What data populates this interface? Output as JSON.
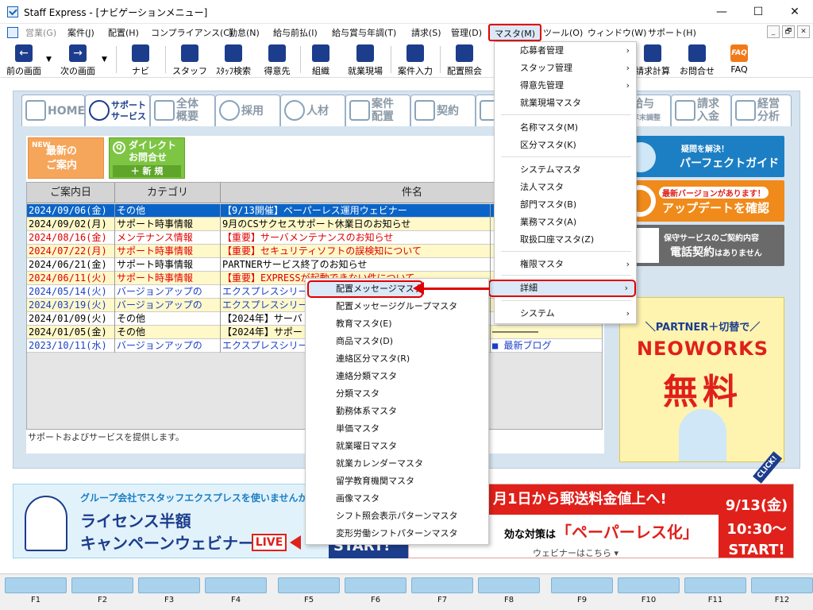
{
  "window": {
    "title": "Staff Express - [ナビゲーションメニュー]",
    "minimize": "—",
    "maximize": "☐",
    "close": "✕"
  },
  "menubar": {
    "items": [
      "営業(G)",
      "案件(J)",
      "配置(H)",
      "コンプライアンス(C)",
      "勤怠(N)",
      "給与前払(I)",
      "給与賞与年調(T)",
      "請求(S)",
      "管理(D)",
      "マスタ(M)",
      "ツール(O)",
      "ウィンドウ(W)",
      "サポート(H)"
    ],
    "mdi": [
      "_",
      "🗗",
      "✕"
    ]
  },
  "toolbar": {
    "items": [
      "前の画面",
      "次の画面",
      "ナビ",
      "スタッフ",
      "ｽﾀｯﾌ検索",
      "得意先",
      "組織",
      "就業現場",
      "案件入力",
      "配置照会",
      "請求計算",
      "お問合せ",
      "FAQ"
    ],
    "faq_icon": "FAQ"
  },
  "tabs": [
    {
      "label": "HOME"
    },
    {
      "label1": "サポート",
      "label2": "サービス"
    },
    {
      "label1": "全体",
      "label2": "概要"
    },
    {
      "label": "採用"
    },
    {
      "label": "人材"
    },
    {
      "label1": "案件",
      "label2": "配置"
    },
    {
      "label": "契約"
    },
    {
      "label1": "給与",
      "label2": "年末調整"
    },
    {
      "label1": "請求",
      "label2": "入金"
    },
    {
      "label1": "経営",
      "label2": "分析"
    }
  ],
  "buttons": {
    "new_vert": "NEW",
    "new_line1": "最新の",
    "new_line2": "ご案内",
    "direct_q": "Q",
    "direct_line1": "ダイレクト",
    "direct_line2": "お問合せ",
    "direct_sub": "＋ 新 規"
  },
  "news": {
    "headers": [
      "ご案内日",
      "カテゴリ",
      "件名"
    ],
    "rows": [
      {
        "date": "2024/09/06(金)",
        "cat": "その他",
        "title": "【9/13開催】ペーパーレス運用ウェビナー",
        "extra": "",
        "style": "selected"
      },
      {
        "date": "2024/09/02(月)",
        "cat": "サポート時事情報",
        "title": "9月のCSサクセスサポート休業日のお知らせ",
        "extra": "",
        "style": "yellow"
      },
      {
        "date": "2024/08/16(金)",
        "cat": "メンテナンス情報",
        "title": "【重要】サーバメンテナンスのお知らせ",
        "extra": "",
        "style": "red"
      },
      {
        "date": "2024/07/22(月)",
        "cat": "サポート時事情報",
        "title": "【重要】セキュリティソフトの誤検知について",
        "extra": "",
        "style": "redyellow"
      },
      {
        "date": "2024/06/21(金)",
        "cat": "サポート時事情報",
        "title": "PARTNERサービス終了のお知らせ",
        "extra": "",
        "style": "white"
      },
      {
        "date": "2024/06/11(火)",
        "cat": "サポート時事情報",
        "title": "【重要】EXPRESSが起動できない件について",
        "extra": "",
        "style": "redyellow"
      },
      {
        "date": "2024/05/14(火)",
        "cat": "バージョンアップの",
        "title": "エクスプレスシリーズ",
        "extra": "",
        "style": "blue"
      },
      {
        "date": "2024/03/19(火)",
        "cat": "バージョンアップの",
        "title": "エクスプレスシリーズ",
        "extra": "",
        "style": "blueyellow"
      },
      {
        "date": "2024/01/09(火)",
        "cat": "その他",
        "title": "【2024年】サーバ",
        "extra": "",
        "style": "white"
      },
      {
        "date": "2024/01/05(金)",
        "cat": "その他",
        "title": "【2024年】サポート",
        "extra": "────────",
        "style": "yellow"
      },
      {
        "date": "2023/10/11(水)",
        "cat": "バージョンアップの",
        "title": "エクスプレスシリーズ",
        "extra": "■ 最新ブログ",
        "style": "blue"
      }
    ],
    "extra_last_fragment": "せ"
  },
  "footnote": "サポートおよびサービスを提供します。",
  "right_banners": {
    "guide_1": "疑問を解決！",
    "guide_2": "パーフェクトガイド",
    "update_1": "最新バージョンがあります！",
    "update_2": "アップデートを確認",
    "contract_1": "保守サービスのご契約内容",
    "contract_2a": "電話契約",
    "contract_2b": "はありません",
    "neo_1": "＼PARTNER＋切替で／",
    "neo_2": "NEOWORKS",
    "neo_3": "無料",
    "neo_4": "CLICK!"
  },
  "bottom_banners": {
    "left_1": "グループ会社でスタッフエクスプレスを使いませんか",
    "left_2": "ライセンス半額",
    "left_3": "キャンペーンウェビナー",
    "left_live": "LIVE",
    "left_start": "START!",
    "right_head": "月1日から郵送料金値上へ!",
    "right_body_pre": "効な対策は",
    "right_body_em": "「ペーパーレス化」",
    "right_web": "ウェビナーはこちら ▾",
    "right_date1": "9/13(金)",
    "right_date2": "10:30～",
    "right_date3": "START!"
  },
  "fkeys": [
    "F1",
    "F2",
    "F3",
    "F4",
    "F5",
    "F6",
    "F7",
    "F8",
    "F9",
    "F10",
    "F11",
    "F12"
  ],
  "master_menu": {
    "items": [
      "応募者管理",
      "スタッフ管理",
      "得意先管理",
      "就業現場マスタ",
      "名称マスタ(M)",
      "区分マスタ(K)",
      "システムマスタ",
      "法人マスタ",
      "部門マスタ(B)",
      "業務マスタ(A)",
      "取扱口座マスタ(Z)",
      "権限マスタ",
      "詳細",
      "システム"
    ],
    "arrow": "›"
  },
  "detail_menu": {
    "items": [
      "配置メッセージマスタ",
      "配置メッセージグループマスタ",
      "教育マスタ(E)",
      "商品マスタ(D)",
      "連絡区分マスタ(R)",
      "連絡分類マスタ",
      "分類マスタ",
      "勤務体系マスタ",
      "単価マスタ",
      "就業曜日マスタ",
      "就業カレンダーマスタ",
      "留学教育機関マスタ",
      "画像マスタ",
      "シフト照会表示パターンマスタ",
      "変形労働シフトパターンマスタ"
    ]
  },
  "colors": {
    "accent_red": "#e00000",
    "navy": "#1c3d8c",
    "selected_row": "#0a64c8",
    "highlight": "#dbe8f8"
  }
}
